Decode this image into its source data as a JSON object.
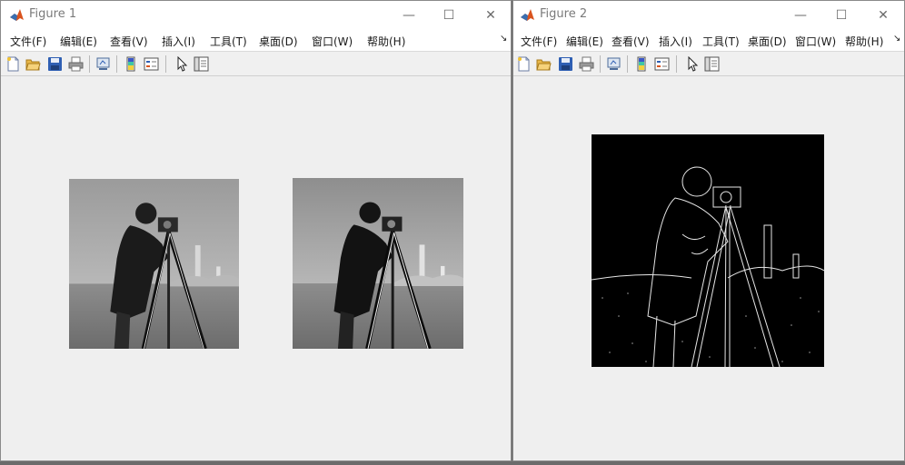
{
  "windows": [
    {
      "id": "figure1",
      "title": "Figure 1",
      "menu": [
        "文件(F)",
        "编辑(E)",
        "查看(V)",
        "插入(I)",
        "工具(T)",
        "桌面(D)",
        "窗口(W)",
        "帮助(H)"
      ],
      "more_glyph": "↘",
      "images": [
        "cameraman-grayscale-original",
        "cameraman-grayscale-processed"
      ]
    },
    {
      "id": "figure2",
      "title": "Figure 2",
      "menu": [
        "文件(F)",
        "编辑(E)",
        "查看(V)",
        "插入(I)",
        "工具(T)",
        "桌面(D)",
        "窗口(W)",
        "帮助(H)"
      ],
      "more_glyph": "↘",
      "images": [
        "cameraman-edge-detection"
      ]
    }
  ],
  "window_controls": {
    "minimize": "—",
    "maximize": "☐",
    "close": "✕"
  },
  "toolbar_icons": [
    "new-figure-icon",
    "open-file-icon",
    "save-icon",
    "print-icon",
    "link-plot-icon",
    "insert-colorbar-icon",
    "insert-legend-icon",
    "edit-plot-arrow-icon",
    "property-inspector-icon"
  ],
  "colors": {
    "menubar_bg": "#ffffff",
    "figure_bg": "#f0f0f0",
    "matlab_orange": "#d9531e"
  }
}
